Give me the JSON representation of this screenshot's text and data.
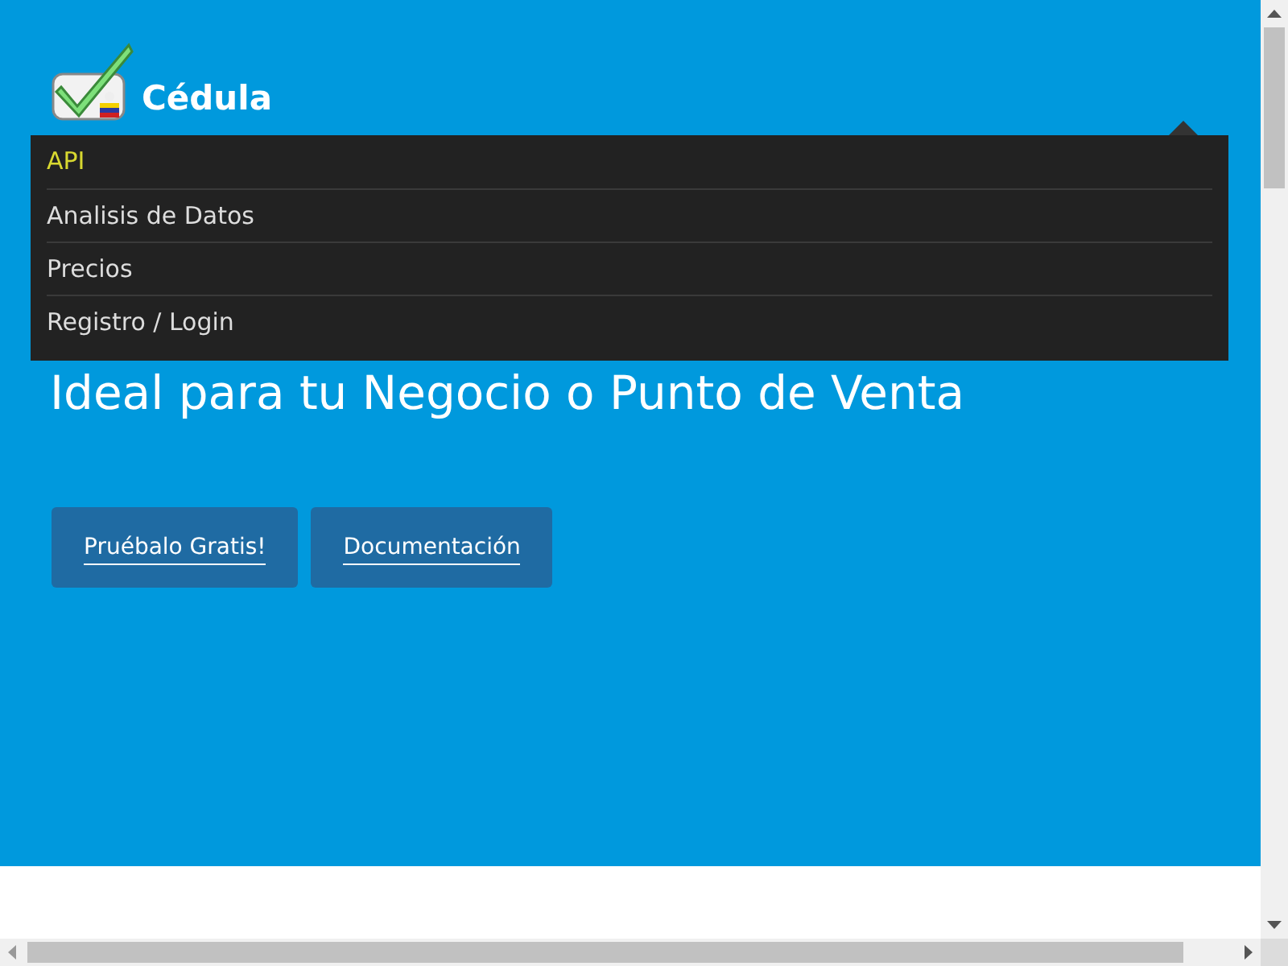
{
  "logo": {
    "text": "Cédula"
  },
  "menu": {
    "items": [
      {
        "label": "API",
        "selected": true
      },
      {
        "label": "Analisis de Datos",
        "selected": false
      },
      {
        "label": "Precios",
        "selected": false
      },
      {
        "label": "Registro / Login",
        "selected": false
      }
    ]
  },
  "hero": {
    "heading": "Ideal para tu Negocio o Punto de Venta",
    "buttons": [
      "Pruébalo Gratis!",
      "Documentación"
    ]
  }
}
